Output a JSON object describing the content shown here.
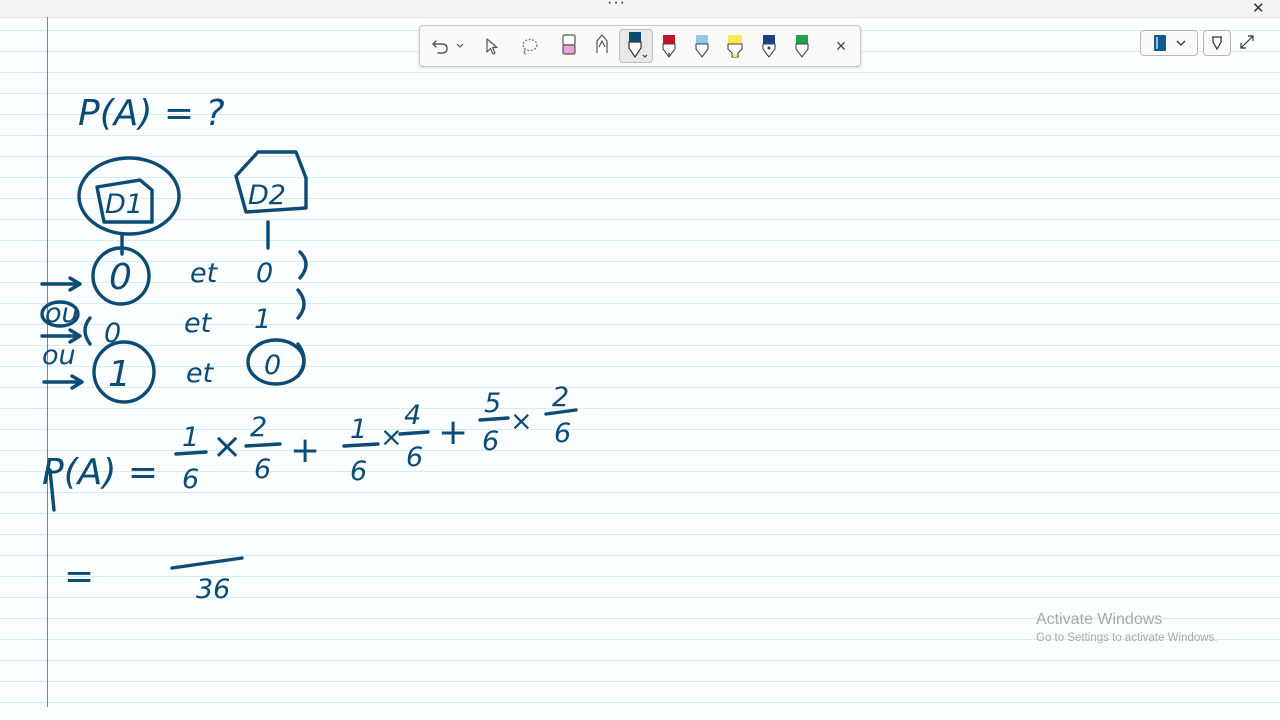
{
  "window": {
    "more_label": "···",
    "close_label": "✕"
  },
  "toolbar": {
    "tools": [
      {
        "name": "undo",
        "icon": "undo-icon"
      },
      {
        "name": "undo-menu",
        "icon": "chevron-down-icon"
      },
      {
        "name": "select",
        "icon": "cursor-icon"
      },
      {
        "name": "lasso",
        "icon": "lasso-icon"
      },
      {
        "name": "eraser",
        "icon": "eraser-icon"
      },
      {
        "name": "calligraphy-pen",
        "icon": "pen-icon"
      }
    ],
    "pens": [
      {
        "name": "blue-pen",
        "color": "#0c4b74",
        "selected": true
      },
      {
        "name": "red-pen",
        "color": "#c8102e"
      },
      {
        "name": "light-blue-pen",
        "color": "#8fc8e8"
      },
      {
        "name": "yellow-highlighter",
        "color": "#ffe94d"
      },
      {
        "name": "navy-pen",
        "color": "#1b3f8f"
      },
      {
        "name": "green-pen",
        "color": "#1aa34a"
      }
    ],
    "close_label": "×"
  },
  "right_tools": {
    "notebook_icon": "notebook-icon",
    "pen-menu_icon": "pen-icon",
    "expand_icon": "expand-icon"
  },
  "watermark": {
    "title": "Activate Windows",
    "subtitle": "Go to Settings to activate Windows."
  },
  "ink_text": {
    "line1": "P(A) = ?",
    "die1": "D1",
    "die2": "D2",
    "row1_left": "0",
    "row1_mid": "et",
    "row1_right": "0",
    "row2_left": "0",
    "row2_mid": "et",
    "row2_right": "1",
    "row3_left": "1",
    "row3_mid": "et",
    "row3_right": "0",
    "ou1": "ou",
    "ou2": "ou",
    "formula_lhs": "P(A) =",
    "f1_num": "1",
    "f1_den": "6",
    "f2_num": "2",
    "f2_den": "6",
    "f3_num": "1",
    "f3_den": "6",
    "f4_num": "4",
    "f4_den": "6",
    "f5_num": "5",
    "f5_den": "6",
    "f6_num": "2",
    "f6_den": "6",
    "times": "×",
    "plus": "+",
    "equals": "=",
    "result_den": "36"
  }
}
